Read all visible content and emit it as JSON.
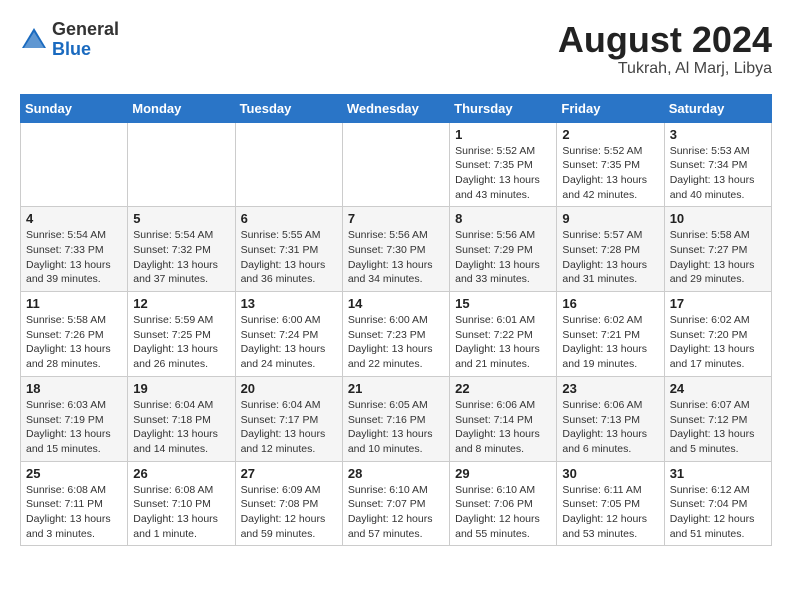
{
  "header": {
    "logo_general": "General",
    "logo_blue": "Blue",
    "title": "August 2024",
    "location": "Tukrah, Al Marj, Libya"
  },
  "weekdays": [
    "Sunday",
    "Monday",
    "Tuesday",
    "Wednesday",
    "Thursday",
    "Friday",
    "Saturday"
  ],
  "weeks": [
    [
      {
        "day": "",
        "info": ""
      },
      {
        "day": "",
        "info": ""
      },
      {
        "day": "",
        "info": ""
      },
      {
        "day": "",
        "info": ""
      },
      {
        "day": "1",
        "info": "Sunrise: 5:52 AM\nSunset: 7:35 PM\nDaylight: 13 hours\nand 43 minutes."
      },
      {
        "day": "2",
        "info": "Sunrise: 5:52 AM\nSunset: 7:35 PM\nDaylight: 13 hours\nand 42 minutes."
      },
      {
        "day": "3",
        "info": "Sunrise: 5:53 AM\nSunset: 7:34 PM\nDaylight: 13 hours\nand 40 minutes."
      }
    ],
    [
      {
        "day": "4",
        "info": "Sunrise: 5:54 AM\nSunset: 7:33 PM\nDaylight: 13 hours\nand 39 minutes."
      },
      {
        "day": "5",
        "info": "Sunrise: 5:54 AM\nSunset: 7:32 PM\nDaylight: 13 hours\nand 37 minutes."
      },
      {
        "day": "6",
        "info": "Sunrise: 5:55 AM\nSunset: 7:31 PM\nDaylight: 13 hours\nand 36 minutes."
      },
      {
        "day": "7",
        "info": "Sunrise: 5:56 AM\nSunset: 7:30 PM\nDaylight: 13 hours\nand 34 minutes."
      },
      {
        "day": "8",
        "info": "Sunrise: 5:56 AM\nSunset: 7:29 PM\nDaylight: 13 hours\nand 33 minutes."
      },
      {
        "day": "9",
        "info": "Sunrise: 5:57 AM\nSunset: 7:28 PM\nDaylight: 13 hours\nand 31 minutes."
      },
      {
        "day": "10",
        "info": "Sunrise: 5:58 AM\nSunset: 7:27 PM\nDaylight: 13 hours\nand 29 minutes."
      }
    ],
    [
      {
        "day": "11",
        "info": "Sunrise: 5:58 AM\nSunset: 7:26 PM\nDaylight: 13 hours\nand 28 minutes."
      },
      {
        "day": "12",
        "info": "Sunrise: 5:59 AM\nSunset: 7:25 PM\nDaylight: 13 hours\nand 26 minutes."
      },
      {
        "day": "13",
        "info": "Sunrise: 6:00 AM\nSunset: 7:24 PM\nDaylight: 13 hours\nand 24 minutes."
      },
      {
        "day": "14",
        "info": "Sunrise: 6:00 AM\nSunset: 7:23 PM\nDaylight: 13 hours\nand 22 minutes."
      },
      {
        "day": "15",
        "info": "Sunrise: 6:01 AM\nSunset: 7:22 PM\nDaylight: 13 hours\nand 21 minutes."
      },
      {
        "day": "16",
        "info": "Sunrise: 6:02 AM\nSunset: 7:21 PM\nDaylight: 13 hours\nand 19 minutes."
      },
      {
        "day": "17",
        "info": "Sunrise: 6:02 AM\nSunset: 7:20 PM\nDaylight: 13 hours\nand 17 minutes."
      }
    ],
    [
      {
        "day": "18",
        "info": "Sunrise: 6:03 AM\nSunset: 7:19 PM\nDaylight: 13 hours\nand 15 minutes."
      },
      {
        "day": "19",
        "info": "Sunrise: 6:04 AM\nSunset: 7:18 PM\nDaylight: 13 hours\nand 14 minutes."
      },
      {
        "day": "20",
        "info": "Sunrise: 6:04 AM\nSunset: 7:17 PM\nDaylight: 13 hours\nand 12 minutes."
      },
      {
        "day": "21",
        "info": "Sunrise: 6:05 AM\nSunset: 7:16 PM\nDaylight: 13 hours\nand 10 minutes."
      },
      {
        "day": "22",
        "info": "Sunrise: 6:06 AM\nSunset: 7:14 PM\nDaylight: 13 hours\nand 8 minutes."
      },
      {
        "day": "23",
        "info": "Sunrise: 6:06 AM\nSunset: 7:13 PM\nDaylight: 13 hours\nand 6 minutes."
      },
      {
        "day": "24",
        "info": "Sunrise: 6:07 AM\nSunset: 7:12 PM\nDaylight: 13 hours\nand 5 minutes."
      }
    ],
    [
      {
        "day": "25",
        "info": "Sunrise: 6:08 AM\nSunset: 7:11 PM\nDaylight: 13 hours\nand 3 minutes."
      },
      {
        "day": "26",
        "info": "Sunrise: 6:08 AM\nSunset: 7:10 PM\nDaylight: 13 hours\nand 1 minute."
      },
      {
        "day": "27",
        "info": "Sunrise: 6:09 AM\nSunset: 7:08 PM\nDaylight: 12 hours\nand 59 minutes."
      },
      {
        "day": "28",
        "info": "Sunrise: 6:10 AM\nSunset: 7:07 PM\nDaylight: 12 hours\nand 57 minutes."
      },
      {
        "day": "29",
        "info": "Sunrise: 6:10 AM\nSunset: 7:06 PM\nDaylight: 12 hours\nand 55 minutes."
      },
      {
        "day": "30",
        "info": "Sunrise: 6:11 AM\nSunset: 7:05 PM\nDaylight: 12 hours\nand 53 minutes."
      },
      {
        "day": "31",
        "info": "Sunrise: 6:12 AM\nSunset: 7:04 PM\nDaylight: 12 hours\nand 51 minutes."
      }
    ]
  ]
}
